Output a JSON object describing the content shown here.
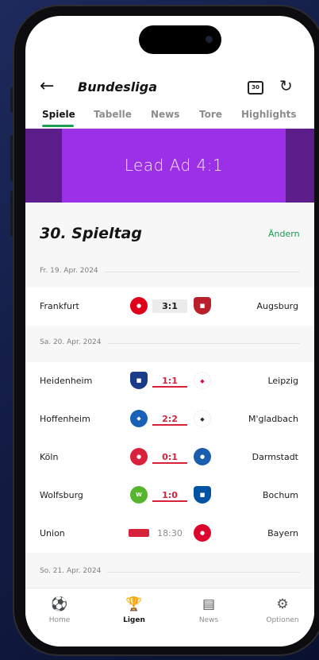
{
  "header": {
    "back_icon": "←",
    "title": "Bundesliga",
    "calendar_day": "30",
    "refresh_icon": "↻"
  },
  "tabs": [
    {
      "label": "Spiele",
      "active": true
    },
    {
      "label": "Tabelle",
      "active": false
    },
    {
      "label": "News",
      "active": false
    },
    {
      "label": "Tore",
      "active": false
    },
    {
      "label": "Highlights",
      "active": false
    }
  ],
  "ad": {
    "label": "Lead Ad 4:1"
  },
  "matchday": {
    "title": "30. Spieltag",
    "change_label": "Ändern"
  },
  "days": [
    {
      "date": "Fr. 19. Apr. 2024"
    },
    {
      "date": "Sa. 20. Apr. 2024"
    },
    {
      "date": "So. 21. Apr. 2024"
    }
  ],
  "matches": [
    {
      "home": "Frankfurt",
      "away": "Augsburg",
      "score": "3:1",
      "state": "final",
      "home_color": "#e1001a",
      "away_color": "#ba1f2c"
    },
    {
      "home": "Heidenheim",
      "away": "Leipzig",
      "score": "1:1",
      "state": "live",
      "home_color": "#1a3b87",
      "away_color": "#dd0741"
    },
    {
      "home": "Hoffenheim",
      "away": "M'gladbach",
      "score": "2:2",
      "state": "live",
      "home_color": "#1961b5",
      "away_color": "#2b2b2b"
    },
    {
      "home": "Köln",
      "away": "Darmstadt",
      "score": "0:1",
      "state": "live",
      "home_color": "#d8213b",
      "away_color": "#1a5cad"
    },
    {
      "home": "Wolfsburg",
      "away": "Bochum",
      "score": "1:0",
      "state": "live",
      "home_color": "#56b42d",
      "away_color": "#0053a0"
    },
    {
      "home": "Union",
      "away": "Bayern",
      "score": "18:30",
      "state": "time",
      "home_color": "#d8213b",
      "away_color": "#dc052d"
    }
  ],
  "bottom_nav": [
    {
      "label": "Home",
      "icon": "⚽",
      "active": false
    },
    {
      "label": "Ligen",
      "icon": "🏆",
      "active": true
    },
    {
      "label": "News",
      "icon": "▤",
      "active": false
    },
    {
      "label": "Optionen",
      "icon": "⚙",
      "active": false
    }
  ]
}
